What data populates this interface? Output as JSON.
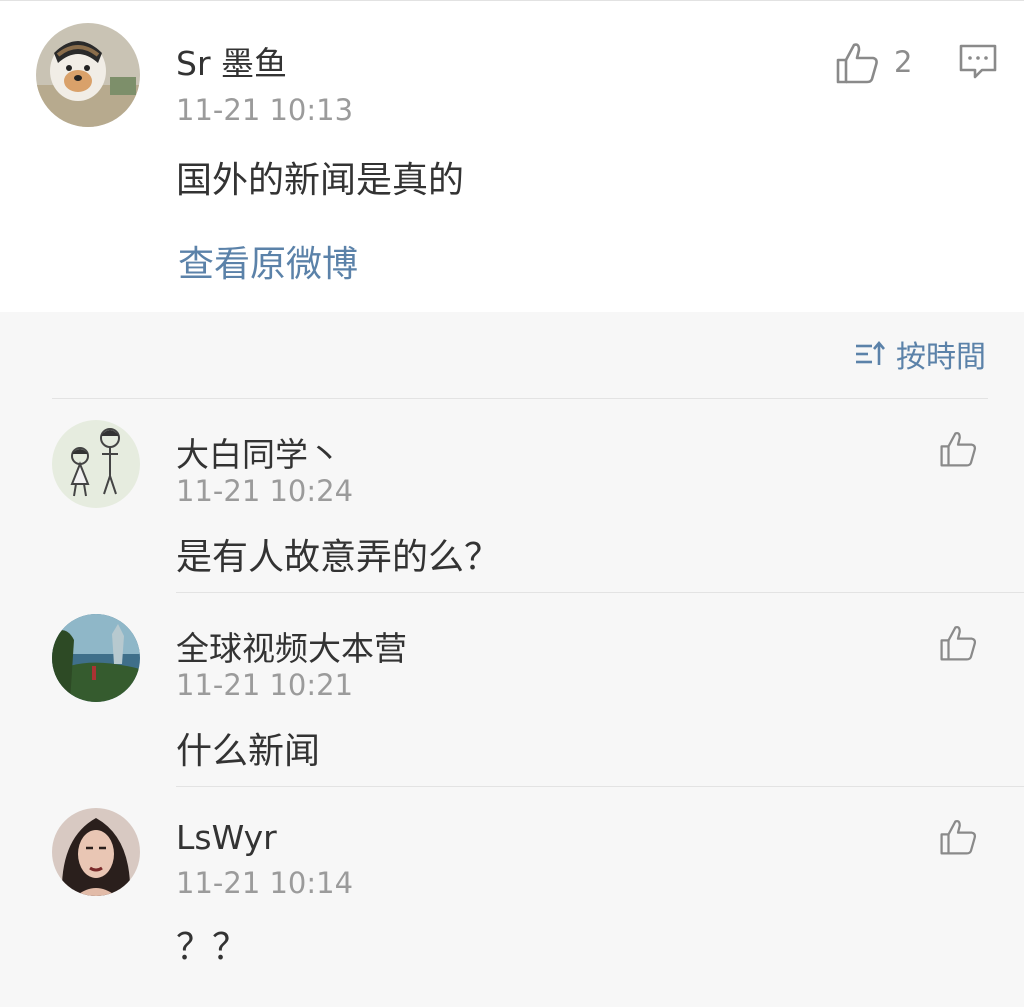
{
  "main_comment": {
    "username": "Sr 墨鱼",
    "time": "11-21 10:13",
    "text": "国外的新闻是真的",
    "likes": "2",
    "view_original": "查看原微博"
  },
  "sort": {
    "label": "按時間"
  },
  "replies": [
    {
      "username": "大白同学丶",
      "time": "11-21 10:24",
      "text": "是有人故意弄的么？"
    },
    {
      "username": "全球视频大本营",
      "time": "11-21 10:21",
      "text": "什么新闻"
    },
    {
      "username": "LsWyr",
      "time": "11-21 10:14",
      "text": "？？"
    }
  ],
  "colors": {
    "link": "#5b82a9",
    "muted": "#9b9b9b",
    "background": "#f7f7f7"
  }
}
